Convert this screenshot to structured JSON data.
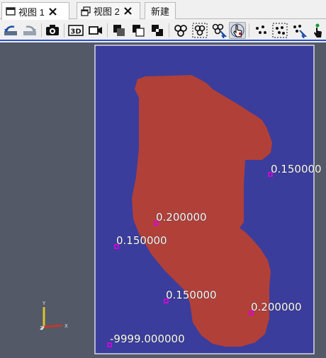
{
  "tabs": [
    {
      "label": "视图 1",
      "active": true
    },
    {
      "label": "视图 2",
      "active": false
    },
    {
      "label": "新建",
      "active": false
    }
  ],
  "toolbar": {
    "buttons": [
      "reset-camera-icon",
      "redo-camera-icon",
      "capture-screenshot-icon",
      "toggle-3d-icon",
      "camera-icon",
      "select-cells-on-icon",
      "select-points-on-icon",
      "select-cells-frustum-icon",
      "select-cells-polygon-icon",
      "select-points-polygon-icon",
      "interactive-select-icon",
      "hover-points-icon",
      "select-points-icon",
      "select-points-frustum-icon",
      "interactive-points-icon",
      "hover-cells-icon"
    ]
  },
  "viewport": {
    "background": "#535966",
    "plane_color": "#3a3d9c",
    "region_color": "#b14039",
    "point_marker_color": "#e000e0",
    "point_labels": [
      "0.150000",
      "0.200000",
      "0.150000",
      "0.150000",
      "0.200000",
      "-9999.000000"
    ],
    "axes": {
      "x": "X",
      "y": "Y",
      "z": "Z"
    }
  }
}
